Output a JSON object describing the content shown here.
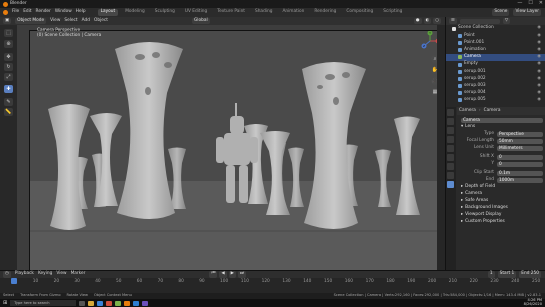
{
  "titlebar": {
    "title": "Blender",
    "controls": [
      "—",
      "☐",
      "✕"
    ]
  },
  "menubar": {
    "menus": [
      "File",
      "Edit",
      "Render",
      "Window",
      "Help"
    ],
    "workspaces": [
      "Layout",
      "Modeling",
      "Sculpting",
      "UV Editing",
      "Texture Paint",
      "Shading",
      "Animation",
      "Rendering",
      "Compositing",
      "Scripting"
    ],
    "active_workspace": "Layout",
    "scene": "Scene",
    "view_layer": "View Layer"
  },
  "viewport_header": {
    "mode": "Object Mode",
    "menus": [
      "View",
      "Select",
      "Add",
      "Object"
    ],
    "orientation": "Global"
  },
  "viewport": {
    "overlay_line1": "Camera Perspective",
    "overlay_line2": "(0) Scene Collection | Camera",
    "gizmo": {
      "x": "X",
      "y": "Y",
      "z": "Z"
    }
  },
  "outliner": {
    "rows": [
      {
        "label": "Scene Collection",
        "icon": "col",
        "selected": false
      },
      {
        "label": "Point",
        "icon": "obj",
        "selected": false
      },
      {
        "label": "Point.001",
        "icon": "obj",
        "selected": false
      },
      {
        "label": "Animation",
        "icon": "obj",
        "selected": false
      },
      {
        "label": "Camera",
        "icon": "cam",
        "selected": true
      },
      {
        "label": "Empty",
        "icon": "obj",
        "selected": false
      },
      {
        "label": "serup.001",
        "icon": "obj",
        "selected": false
      },
      {
        "label": "serup.002",
        "icon": "obj",
        "selected": false
      },
      {
        "label": "serup.003",
        "icon": "obj",
        "selected": false
      },
      {
        "label": "serup.004",
        "icon": "obj",
        "selected": false
      },
      {
        "label": "serup.005",
        "icon": "obj",
        "selected": false
      }
    ]
  },
  "properties": {
    "header_left": "Camera",
    "header_right": "Camera",
    "object_name": "Camera",
    "lens_section": "Lens",
    "fields": [
      {
        "label": "Type",
        "value": "Perspective"
      },
      {
        "label": "Focal Length",
        "value": "50mm"
      },
      {
        "label": "Lens Unit",
        "value": "Millimeters"
      },
      {
        "label": "Shift X",
        "value": "0"
      },
      {
        "label": "Y",
        "value": "0"
      },
      {
        "label": "Clip Start",
        "value": "0.1m"
      },
      {
        "label": "End",
        "value": "1000m"
      }
    ],
    "sections": [
      "Depth of Field",
      "Camera",
      "Safe Areas",
      "Background Images",
      "Viewport Display",
      "Custom Properties"
    ]
  },
  "timeline": {
    "menus": [
      "Playback",
      "Keying",
      "View",
      "Marker"
    ],
    "current_frame": "1",
    "start_label": "Start",
    "start": "1",
    "end_label": "End",
    "end": "250",
    "ticks": [
      "0",
      "10",
      "20",
      "30",
      "40",
      "50",
      "60",
      "70",
      "80",
      "90",
      "100",
      "110",
      "120",
      "130",
      "140",
      "150",
      "160",
      "170",
      "180",
      "190",
      "200",
      "210",
      "220",
      "230",
      "240",
      "250"
    ]
  },
  "statusbar": {
    "items": [
      "Select",
      "Transform From Gizmo",
      "Rotate View",
      "Object Context Menu"
    ],
    "stats": "Scene Collection | Camera | Verts:292,160 | Faces:292,000 | Tris:584,000 | Objects:1/16 | Mem: 143.4 MiB | v2.83.1"
  },
  "taskbar": {
    "search_placeholder": "Type here to search",
    "time": "4:26 PM",
    "date": "8/26/2020"
  }
}
